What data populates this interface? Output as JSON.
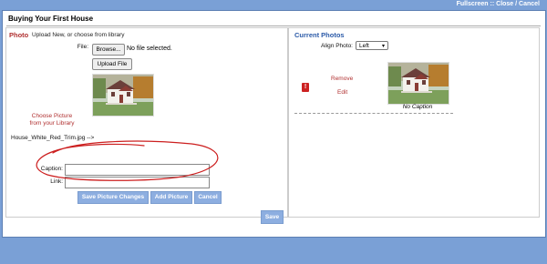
{
  "toplinks": {
    "fullscreen": "Fullscreen",
    "sep": " :: ",
    "close": "Close / Cancel"
  },
  "title": "Buying Your First House",
  "photo": {
    "heading": "Photo",
    "subheading": "Upload New, or choose from library",
    "file_label": "File:",
    "browse_label": "Browse...",
    "file_status": "No file selected.",
    "upload_label": "Upload File",
    "choose_line1": "Choose Picture",
    "choose_line2": "from your Library",
    "filename": "House_White_Red_Trim.jpg -->",
    "caption_label": "Caption:",
    "caption_value": "",
    "link_label": "Link:",
    "link_value": "",
    "save_changes_label": "Save Picture Changes",
    "add_picture_label": "Add Picture",
    "cancel_label": "Cancel"
  },
  "current": {
    "heading": "Current Photos",
    "align_label": "Align Photo:",
    "align_value": "Left",
    "remove_label": "Remove",
    "edit_label": "Edit",
    "no_caption": "No Caption"
  },
  "save_label": "Save",
  "colors": {
    "accent_blue": "#8daee0",
    "link_red": "#b03030",
    "annotation_red": "#cc1f1f",
    "header_blue": "#2b5aa8"
  }
}
